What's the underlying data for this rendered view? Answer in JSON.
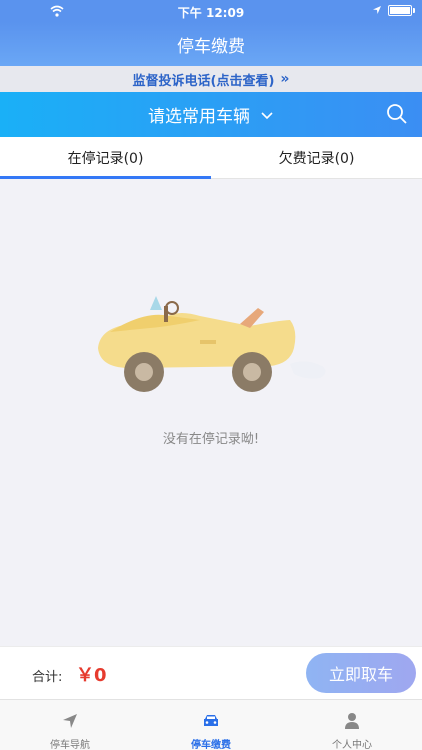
{
  "status_bar": {
    "time": "下午 12:09"
  },
  "nav": {
    "title": "停车缴费"
  },
  "notice": {
    "text": "监督投诉电话(点击查看)",
    "chevron": "»"
  },
  "vehicle_bar": {
    "select_label": "请选常用车辆",
    "icon": "search-icon"
  },
  "tabs": [
    {
      "label": "在停记录(0)",
      "active": true
    },
    {
      "label": "欠费记录(0)",
      "active": false
    }
  ],
  "empty": {
    "message": "没有在停记录呦!"
  },
  "bottom": {
    "total_label": "合计:",
    "total_value": "￥0",
    "action_label": "立即取车"
  },
  "tab_bar": [
    {
      "label": "停车导航",
      "icon": "navigation-arrow-icon",
      "active": false
    },
    {
      "label": "停车缴费",
      "icon": "car-icon",
      "active": true
    },
    {
      "label": "个人中心",
      "icon": "user-icon",
      "active": false
    }
  ],
  "colors": {
    "accent": "#3478f6",
    "price": "#e63b2e",
    "active_tab": "#2a6fe8"
  }
}
